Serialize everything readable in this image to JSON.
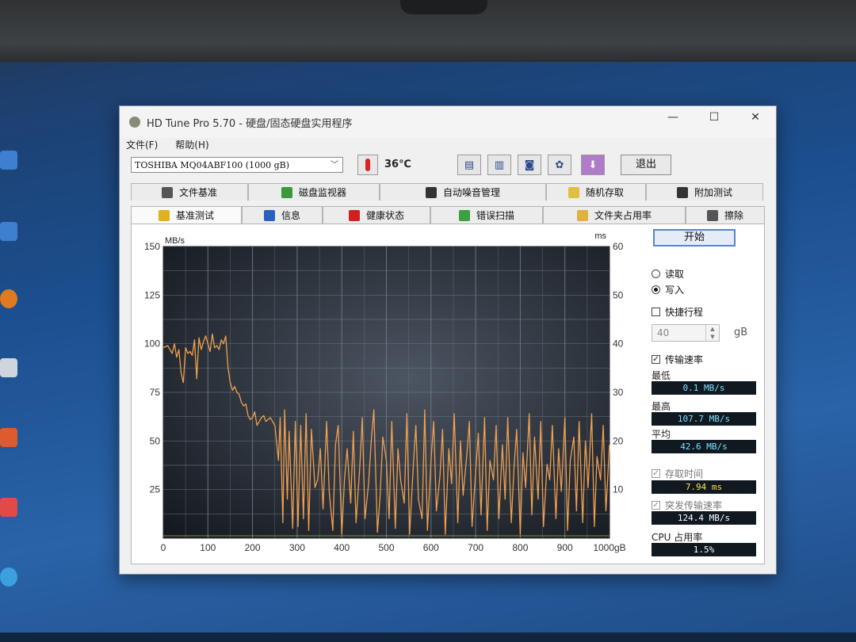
{
  "window": {
    "title": "HD Tune Pro 5.70 - 硬盘/固态硬盘实用程序",
    "minimize": "—",
    "maximize": "☐",
    "close": "✕"
  },
  "menu": {
    "file": "文件(F)",
    "help": "帮助(H)"
  },
  "toolbar": {
    "drive": "TOSHIBA MQ04ABF100 (1000 gB)",
    "temperature": "36℃",
    "exit": "退出"
  },
  "tabs_top": [
    {
      "label": "文件基准",
      "icon": "file-benchmark-icon"
    },
    {
      "label": "磁盘监视器",
      "icon": "disk-monitor-icon"
    },
    {
      "label": "自动噪音管理",
      "icon": "speaker-icon"
    },
    {
      "label": "随机存取",
      "icon": "random-access-icon"
    },
    {
      "label": "附加测试",
      "icon": "extra-tests-icon"
    }
  ],
  "tabs_bottom": [
    {
      "label": "基准测试",
      "icon": "benchmark-bulb-icon"
    },
    {
      "label": "信息",
      "icon": "info-icon"
    },
    {
      "label": "健康状态",
      "icon": "health-cross-icon"
    },
    {
      "label": "错误扫描",
      "icon": "magnifier-icon"
    },
    {
      "label": "文件夹占用率",
      "icon": "folder-icon"
    },
    {
      "label": "擦除",
      "icon": "trash-icon"
    }
  ],
  "side": {
    "start": "开始",
    "read": "读取",
    "write": "写入",
    "short_stroke": "快捷行程",
    "short_stroke_value": "40",
    "short_stroke_unit": "gB",
    "transfer_rate": "传输速率",
    "min_label": "最低",
    "min_value": "0.1 MB/s",
    "max_label": "最高",
    "max_value": "107.7 MB/s",
    "avg_label": "平均",
    "avg_value": "42.6 MB/s",
    "access_time": "存取时间",
    "access_value": "7.94 ms",
    "burst_rate": "突发传输速率",
    "burst_value": "124.4 MB/s",
    "cpu_label": "CPU 占用率",
    "cpu_value": "1.5%"
  },
  "chart_data": {
    "type": "line",
    "ylabel_left": "MB/s",
    "ylabel_right": "ms",
    "y_left_ticks": [
      "150",
      "125",
      "100",
      "75",
      "50",
      "25"
    ],
    "y_right_ticks": [
      "60",
      "50",
      "40",
      "30",
      "20",
      "10"
    ],
    "x_ticks": [
      "0",
      "100",
      "200",
      "300",
      "400",
      "500",
      "600",
      "700",
      "800",
      "900",
      "1000gB"
    ],
    "xlim": [
      0,
      1000
    ],
    "ylim": [
      0,
      150
    ],
    "series": [
      {
        "color": "#f0a050",
        "x": [
          0,
          10,
          20,
          25,
          30,
          35,
          40,
          45,
          50,
          55,
          60,
          65,
          70,
          75,
          80,
          85,
          90,
          95,
          100,
          105,
          110,
          115,
          120,
          125,
          130,
          135,
          140,
          145,
          150,
          155,
          160,
          165,
          170,
          175,
          180,
          185,
          190,
          195,
          200,
          205,
          210,
          215,
          220,
          225,
          230,
          240,
          250,
          258,
          262,
          268,
          272,
          278,
          282,
          290,
          296,
          302,
          308,
          314,
          320,
          326,
          332,
          340,
          346,
          352,
          358,
          366,
          372,
          380,
          386,
          392,
          400,
          406,
          412,
          420,
          426,
          432,
          440,
          446,
          452,
          460,
          466,
          472,
          480,
          486,
          492,
          500,
          506,
          512,
          520,
          526,
          532,
          540,
          546,
          552,
          560,
          566,
          572,
          580,
          586,
          592,
          600,
          606,
          612,
          620,
          626,
          632,
          640,
          646,
          652,
          660,
          666,
          672,
          680,
          686,
          692,
          700,
          706,
          712,
          720,
          726,
          732,
          740,
          746,
          752,
          760,
          766,
          772,
          780,
          786,
          792,
          800,
          806,
          812,
          820,
          826,
          832,
          840,
          846,
          852,
          860,
          866,
          872,
          880,
          886,
          892,
          900,
          906,
          912,
          920,
          926,
          932,
          940,
          946,
          952,
          960,
          966,
          972,
          980,
          986,
          992,
          1000
        ],
        "y": [
          98,
          99,
          95,
          100,
          93,
          97,
          85,
          80,
          98,
          95,
          96,
          94,
          102,
          82,
          103,
          97,
          101,
          104,
          100,
          96,
          105,
          98,
          99,
          97,
          102,
          100,
          104,
          88,
          80,
          76,
          78,
          75,
          74,
          70,
          68,
          69,
          63,
          61,
          62,
          65,
          58,
          60,
          62,
          63,
          60,
          62,
          58,
          40,
          62,
          8,
          66,
          20,
          55,
          5,
          60,
          6,
          58,
          10,
          64,
          4,
          56,
          26,
          30,
          46,
          15,
          60,
          24,
          4,
          48,
          58,
          2,
          30,
          46,
          18,
          55,
          8,
          35,
          62,
          10,
          28,
          50,
          66,
          3,
          22,
          52,
          40,
          10,
          60,
          5,
          46,
          30,
          18,
          64,
          2,
          36,
          58,
          20,
          10,
          66,
          4,
          40,
          60,
          14,
          32,
          56,
          2,
          46,
          28,
          64,
          8,
          50,
          22,
          42,
          60,
          6,
          34,
          54,
          12,
          62,
          4,
          40,
          30,
          58,
          10,
          48,
          20,
          62,
          8,
          36,
          56,
          2,
          44,
          26,
          64,
          12,
          52,
          20,
          60,
          6,
          38,
          30,
          58,
          10,
          46,
          24,
          62,
          4,
          40,
          52,
          14,
          60,
          8,
          50,
          26,
          64,
          6,
          42,
          30,
          58,
          14,
          48
        ]
      }
    ]
  }
}
